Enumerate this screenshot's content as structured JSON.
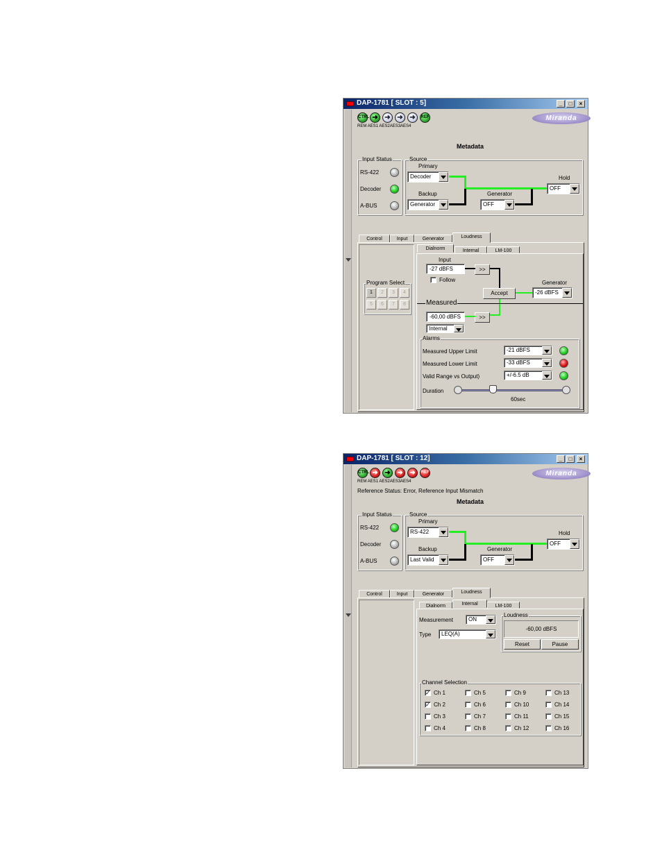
{
  "window1": {
    "title": "DAP-1781 [ SLOT : 5]",
    "icon_labels": "REM AES1 AES2AES3AES4",
    "icons": [
      {
        "name": "rem-status-icon",
        "text": "CTRL",
        "state": "green"
      },
      {
        "name": "aes1-status-icon",
        "text": "",
        "state": "green"
      },
      {
        "name": "aes2-status-icon",
        "text": "",
        "state": "white"
      },
      {
        "name": "aes3-status-icon",
        "text": "",
        "state": "white"
      },
      {
        "name": "aes4-status-icon",
        "text": "",
        "state": "white"
      },
      {
        "name": "ref-status-icon",
        "text": "REF",
        "state": "green"
      }
    ],
    "logo": "Miranda",
    "metadata_title": "Metadata",
    "input_status": {
      "label": "Input Status",
      "rows": [
        {
          "label": "RS-422",
          "state": "off"
        },
        {
          "label": "Decoder",
          "state": "on"
        },
        {
          "label": "A-BUS",
          "state": "off"
        }
      ]
    },
    "source": {
      "label": "Source",
      "primary_label": "Primary",
      "primary_value": "Decoder",
      "backup_label": "Backup",
      "backup_value": "Generator",
      "generator_label": "Generator",
      "generator_value": "OFF",
      "hold_label": "Hold",
      "hold_value": "OFF"
    },
    "tabs": [
      "Control",
      "Input",
      "Generator",
      "Loudness"
    ],
    "subtabs": [
      "Dialnorm",
      "Internal",
      "LM-100"
    ],
    "program_select": {
      "label": "Program Select",
      "buttons": [
        "1",
        "2",
        "3",
        "4",
        "5",
        "6",
        "7",
        "8"
      ]
    },
    "dialnorm": {
      "input_label": "Input",
      "input_value": "-27 dBFS",
      "arrow_btn": ">>",
      "follow_label": "Follow",
      "accept_btn": "Accept",
      "generator_label": "Generator",
      "generator_value": "-26 dBFS",
      "measured_label": "Measured",
      "measured_value": "-60,00 dBFS",
      "measured_arrow_btn": ">>",
      "measured_source": "Internal"
    },
    "alarms": {
      "label": "Alarms",
      "rows": [
        {
          "label": "Measured Upper Limit",
          "value": "-21 dBFS",
          "state": "on"
        },
        {
          "label": "Measured Lower Limit",
          "value": "-33 dBFS",
          "state": "red"
        },
        {
          "label": "Valid Range vs Output)",
          "value": "+/-6.5 dB",
          "state": "on"
        }
      ],
      "duration_label": "Duration",
      "duration_value": "60sec",
      "duration_fraction": 0.29
    }
  },
  "window2": {
    "title": "DAP-1781 [ SLOT : 12]",
    "icon_labels": "REM AES1 AES2AES3AES4",
    "icons": [
      {
        "name": "rem-status-icon",
        "text": "CTRL",
        "state": "green"
      },
      {
        "name": "aes1-status-icon",
        "text": "",
        "state": "red"
      },
      {
        "name": "aes2-status-icon",
        "text": "",
        "state": "green"
      },
      {
        "name": "aes3-status-icon",
        "text": "",
        "state": "red"
      },
      {
        "name": "aes4-status-icon",
        "text": "",
        "state": "red"
      },
      {
        "name": "ref-status-icon",
        "text": "REF",
        "state": "red"
      }
    ],
    "logo": "Miranda",
    "reference_status": "Reference Status: Error, Reference Input Mismatch",
    "metadata_title": "Metadata",
    "input_status": {
      "label": "Input Status",
      "rows": [
        {
          "label": "RS-422",
          "state": "on"
        },
        {
          "label": "Decoder",
          "state": "off"
        },
        {
          "label": "A-BUS",
          "state": "off"
        }
      ]
    },
    "source": {
      "label": "Source",
      "primary_label": "Primary",
      "primary_value": "RS-422",
      "backup_label": "Backup",
      "backup_value": "Last Valid",
      "generator_label": "Generator",
      "generator_value": "OFF",
      "hold_label": "Hold",
      "hold_value": "OFF"
    },
    "tabs": [
      "Control",
      "Input",
      "Generator",
      "Loudness"
    ],
    "subtabs": [
      "Dialnorm",
      "Internal",
      "LM-100"
    ],
    "internal": {
      "measurement_label": "Measurement",
      "measurement_value": "ON",
      "type_label": "Type",
      "type_value": "LEQ(A)",
      "loudness_label": "Loudness",
      "loudness_value": "-60,00 dBFS",
      "reset_btn": "Reset",
      "pause_btn": "Pause",
      "channel_selection_label": "Channel Selection",
      "channels": [
        {
          "label": "Ch 1",
          "checked": true
        },
        {
          "label": "Ch 5",
          "checked": false
        },
        {
          "label": "Ch 9",
          "checked": false
        },
        {
          "label": "Ch 13",
          "checked": false
        },
        {
          "label": "Ch 2",
          "checked": true
        },
        {
          "label": "Ch 6",
          "checked": false
        },
        {
          "label": "Ch 10",
          "checked": false
        },
        {
          "label": "Ch 14",
          "checked": false
        },
        {
          "label": "Ch 3",
          "checked": false
        },
        {
          "label": "Ch 7",
          "checked": false
        },
        {
          "label": "Ch 11",
          "checked": false
        },
        {
          "label": "Ch 15",
          "checked": false
        },
        {
          "label": "Ch 4",
          "checked": false
        },
        {
          "label": "Ch 8",
          "checked": false
        },
        {
          "label": "Ch 12",
          "checked": false
        },
        {
          "label": "Ch 16",
          "checked": false
        }
      ]
    }
  }
}
